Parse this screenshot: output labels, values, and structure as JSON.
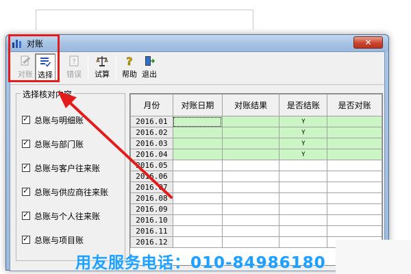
{
  "window": {
    "title": "对账",
    "close_glyph": "✕"
  },
  "toolbar": {
    "buttons": [
      {
        "label": "对账",
        "icon": "reconcile-icon",
        "enabled": false
      },
      {
        "label": "选择",
        "icon": "select-list-icon",
        "enabled": true,
        "pressed": true
      },
      {
        "label": "错误",
        "icon": "error-report-icon",
        "enabled": false
      },
      {
        "label": "试算",
        "icon": "balance-scale-icon",
        "enabled": true
      },
      {
        "label": "帮助",
        "icon": "help-icon",
        "enabled": true
      },
      {
        "label": "退出",
        "icon": "exit-door-icon",
        "enabled": true
      }
    ]
  },
  "options": {
    "legend": "选择核对内容",
    "items": [
      {
        "label": "总账与明细账",
        "checked": true
      },
      {
        "label": "总账与部门账",
        "checked": true
      },
      {
        "label": "总账与客户往来账",
        "checked": true
      },
      {
        "label": "总账与供应商往来账",
        "checked": true
      },
      {
        "label": "总账与个人往来账",
        "checked": true
      },
      {
        "label": "总账与项目账",
        "checked": true
      }
    ]
  },
  "grid": {
    "columns": [
      "月份",
      "对账日期",
      "对账结果",
      "是否结账",
      "是否对账"
    ],
    "rows": [
      {
        "month": "2016.01",
        "date": "",
        "result": "",
        "closed": "Y",
        "reconciled": ""
      },
      {
        "month": "2016.02",
        "date": "",
        "result": "",
        "closed": "Y",
        "reconciled": ""
      },
      {
        "month": "2016.03",
        "date": "",
        "result": "",
        "closed": "Y",
        "reconciled": ""
      },
      {
        "month": "2016.04",
        "date": "",
        "result": "",
        "closed": "Y",
        "reconciled": ""
      },
      {
        "month": "2016.05",
        "date": "",
        "result": "",
        "closed": "",
        "reconciled": ""
      },
      {
        "month": "2016.06",
        "date": "",
        "result": "",
        "closed": "",
        "reconciled": ""
      },
      {
        "month": "2016.07",
        "date": "",
        "result": "",
        "closed": "",
        "reconciled": ""
      },
      {
        "month": "2016.08",
        "date": "",
        "result": "",
        "closed": "",
        "reconciled": ""
      },
      {
        "month": "2016.09",
        "date": "",
        "result": "",
        "closed": "",
        "reconciled": ""
      },
      {
        "month": "2016.10",
        "date": "",
        "result": "",
        "closed": "",
        "reconciled": ""
      },
      {
        "month": "2016.11",
        "date": "",
        "result": "",
        "closed": "",
        "reconciled": ""
      },
      {
        "month": "2016.12",
        "date": "",
        "result": "",
        "closed": "",
        "reconciled": ""
      }
    ]
  },
  "watermark": "用友服务电话：010-84986180",
  "colors": {
    "highlight": "#e31b1b",
    "closed_row": "#ccf5c6",
    "watermark": "#1fa0ff"
  }
}
